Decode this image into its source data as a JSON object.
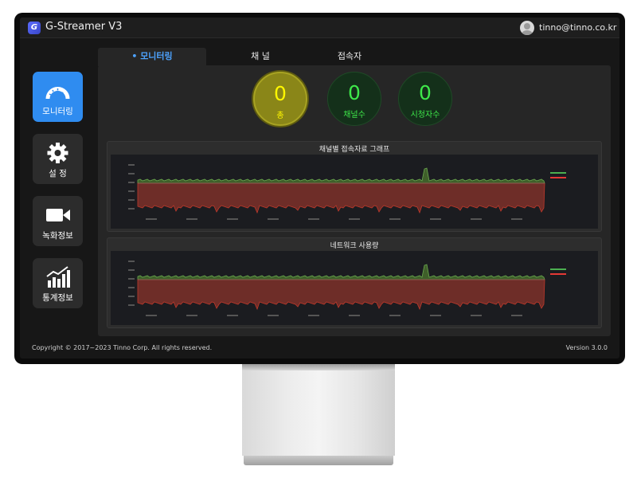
{
  "app": {
    "logo_letter": "G",
    "title": "G-Streamer V3",
    "user": "tinno@tinno.co.kr"
  },
  "sidebar": {
    "items": [
      {
        "label": "모니터링",
        "icon": "gauge-icon",
        "active": true
      },
      {
        "label": "설 정",
        "icon": "gear-icon",
        "active": false
      },
      {
        "label": "녹화정보",
        "icon": "video-camera-icon",
        "active": false
      },
      {
        "label": "통계정보",
        "icon": "bar-chart-icon",
        "active": false
      }
    ]
  },
  "tabs": [
    {
      "label": "• 모니터링",
      "active": true
    },
    {
      "label": "채 널",
      "active": false
    },
    {
      "label": "접속자",
      "active": false
    }
  ],
  "stats": [
    {
      "value": "0",
      "label": "총",
      "color": "#fff700"
    },
    {
      "value": "0",
      "label": "채널수",
      "color": "#3ee84a"
    },
    {
      "value": "0",
      "label": "시청자수",
      "color": "#3ee84a"
    }
  ],
  "graphs": [
    {
      "title": "채널별 접속자료 그래프"
    },
    {
      "title": "네트워크 사용량"
    }
  ],
  "colors": {
    "accent": "#2f8cf0",
    "received": "#4caf50",
    "sent": "#e53935"
  },
  "footer": {
    "copyright": "Copyright © 2017~2023 Tinno Corp. All rights reserved.",
    "version": "Version 3.0.0"
  }
}
